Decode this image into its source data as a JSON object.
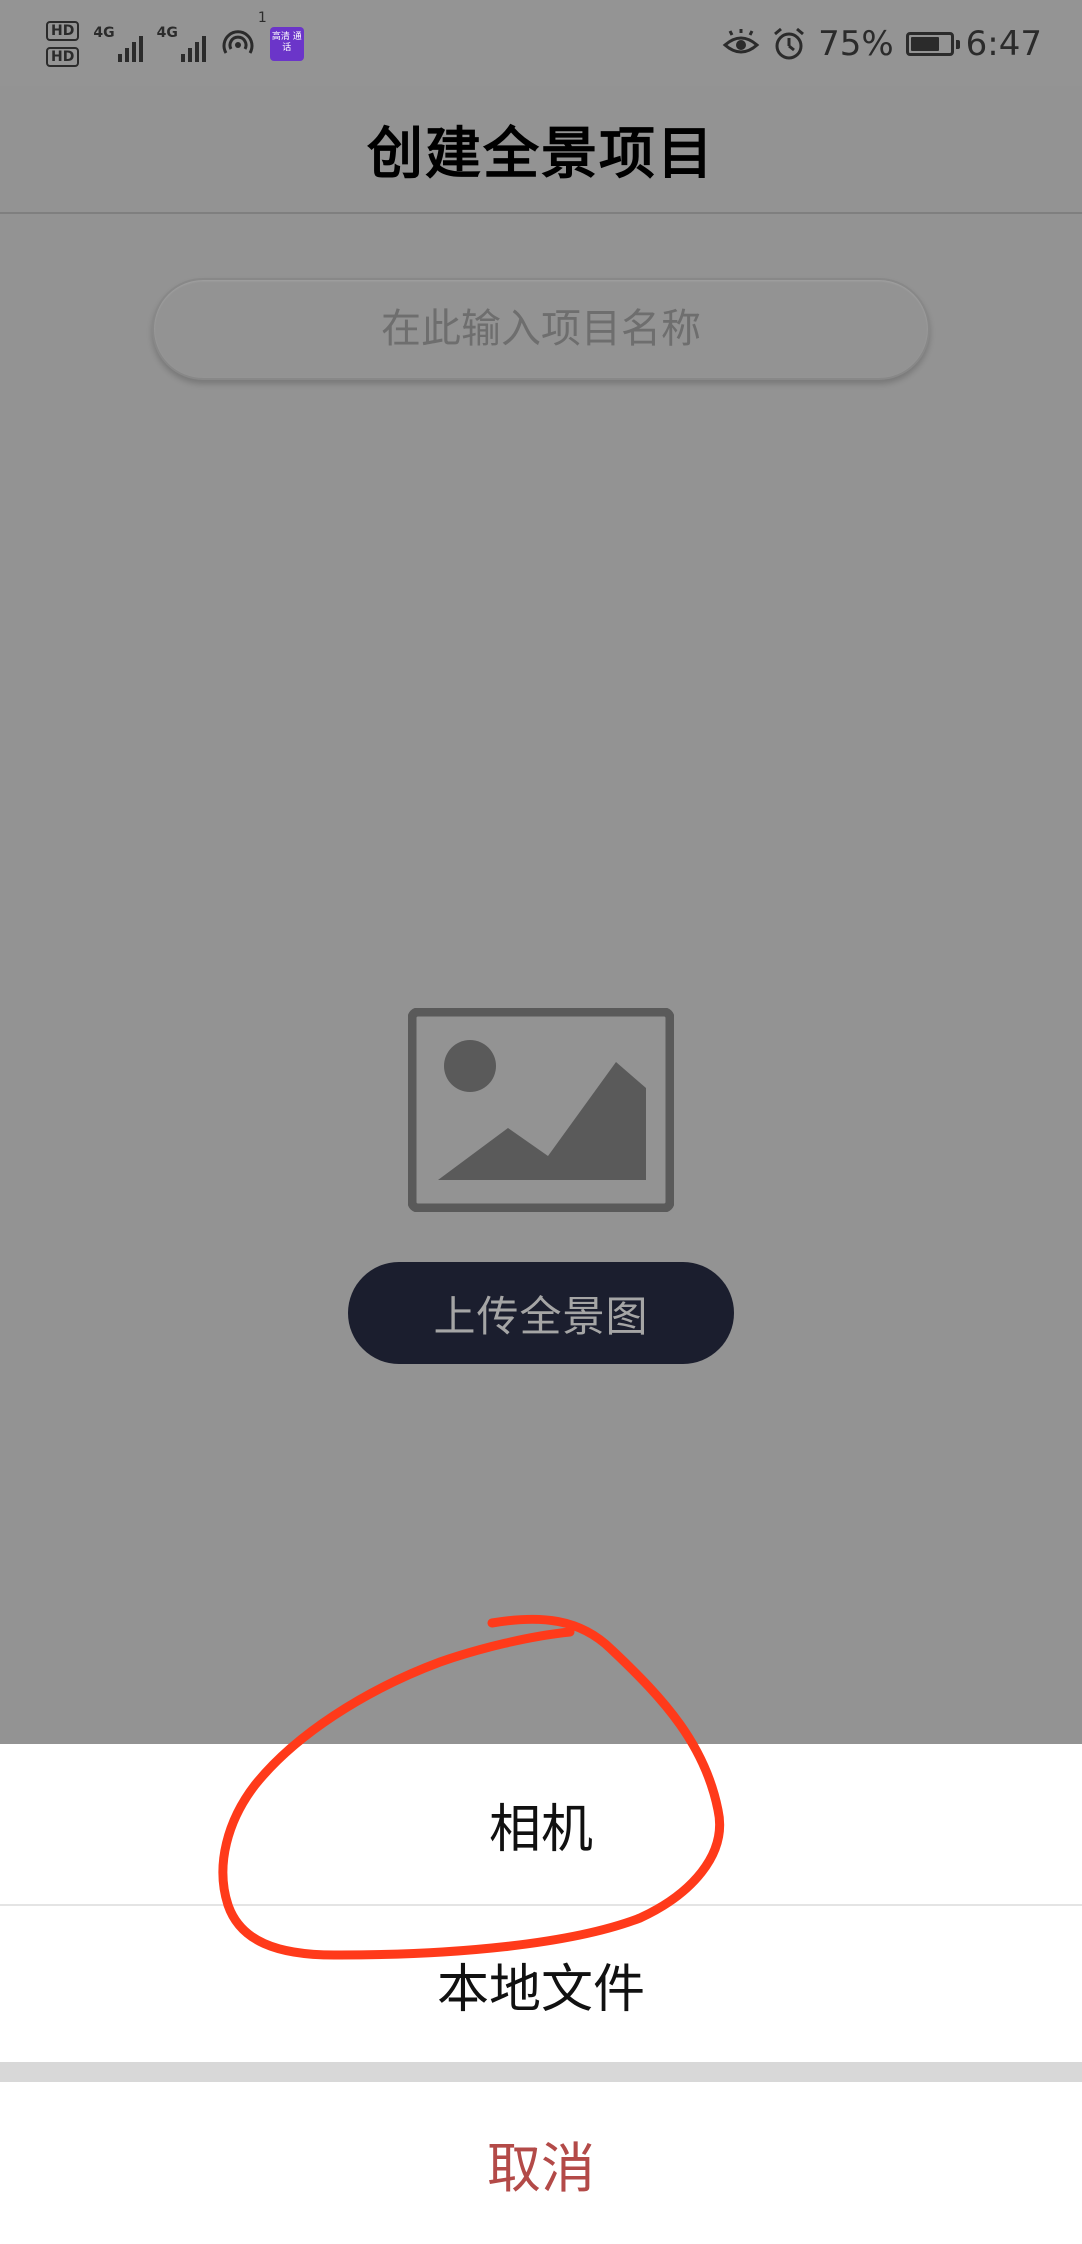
{
  "status_bar": {
    "hd_top": "HD",
    "hd_bottom": "HD",
    "network_1": "4G",
    "network_2": "4G",
    "notification_count": "1",
    "app_badge_text": "高清 通话",
    "battery_percent": "75%",
    "battery_level": 0.75,
    "time": "6:47"
  },
  "header": {
    "title": "创建全景项目"
  },
  "form": {
    "name_placeholder": "在此输入项目名称",
    "name_value": ""
  },
  "upload": {
    "button_label": "上传全景图"
  },
  "action_sheet": {
    "camera_label": "相机",
    "local_file_label": "本地文件",
    "cancel_label": "取消"
  },
  "colors": {
    "overlay_gray": "#939393",
    "upload_button_bg": "#1b1e2e",
    "cancel_text": "#b34a48",
    "annotation_red": "#ff3a1a"
  }
}
